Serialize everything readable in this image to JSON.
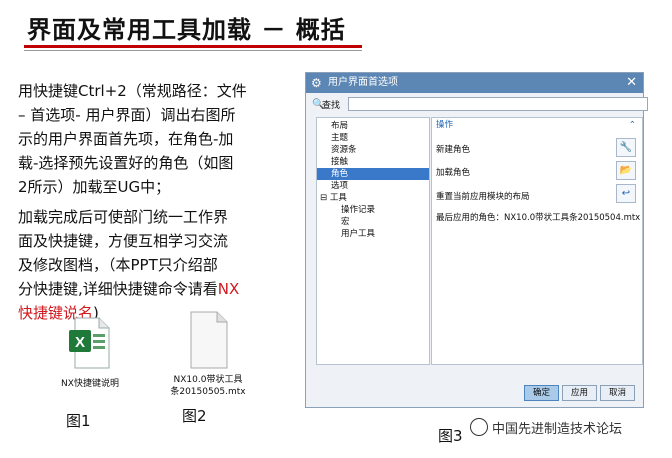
{
  "slide": {
    "title": "界面及常用工具加载 － 概括",
    "para1_parts": [
      "用快捷键Ctrl+2（常规路径：文件",
      "– 首选项- 用户界面）调出右图所",
      "示的用户界面首先项，在角色-加",
      "载-选择预先设置好的角色（如图",
      "2所示）加载至UG中；"
    ],
    "para2_parts": [
      "加载完成后可使部门统一工作界",
      "面及快捷键，方便互相学习交流",
      "及修改图档，（本PPT只介绍部",
      "分快捷键,详细快捷键命令请看"
    ],
    "para2_red1": "NX",
    "para2_red2": "快捷键说名",
    "para2_tail": ")",
    "file1_name": "NX快捷键说明",
    "file2_name_l1": "NX10.0带状工具",
    "file2_name_l2": "条20150505.mtx",
    "caption1": "图1",
    "caption2": "图2",
    "caption3": "图3",
    "watermark": "中国先进制造技术论坛",
    "accent_color": "#c00000"
  },
  "dialog": {
    "title": "用户界面首选项",
    "search_label": "查找",
    "search_value": "",
    "tree": [
      "布局",
      "主题",
      "资源条",
      "接触",
      "角色",
      "选项",
      "工具",
      "操作记录",
      "宏",
      "用户工具"
    ],
    "selected": "角色",
    "section": "操作",
    "rows": [
      "新建角色",
      "加载角色",
      "重置当前应用模块的布局",
      "最后应用的角色：NX10.0带状工具条20150504.mtx"
    ],
    "buttons": [
      "确定",
      "应用",
      "取消"
    ]
  }
}
